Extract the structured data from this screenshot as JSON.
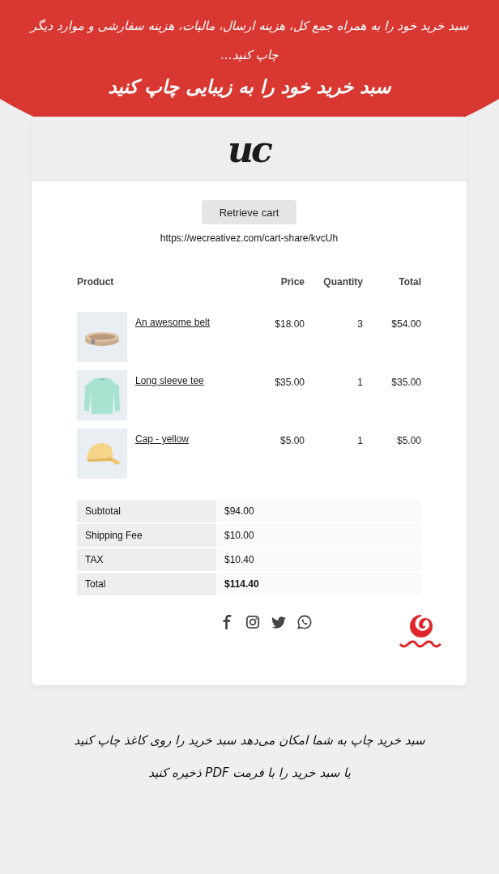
{
  "banner": {
    "subtitle": "سبد خرید خود را به همراه جمع کل، هزینه ارسال، مالیات، هزینه سفارشی و موارد دیگر چاپ کنید...",
    "title": "سبد خرید خود را به زیبایی چاپ کنید"
  },
  "card": {
    "logo": "uc",
    "retrieve_button": "Retrieve cart",
    "share_url": "https://wecreativez.com/cart-share/kvcUh",
    "table": {
      "columns": [
        "Product",
        "Price",
        "Quantity",
        "Total"
      ],
      "rows": [
        {
          "kind": "belt",
          "name": "An awesome belt",
          "price": "$18.00",
          "quantity": "3",
          "total": "$54.00"
        },
        {
          "kind": "shirt",
          "name": "Long sleeve tee",
          "price": "$35.00",
          "quantity": "1",
          "total": "$35.00"
        },
        {
          "kind": "cap",
          "name": "Cap - yellow",
          "price": "$5.00",
          "quantity": "1",
          "total": "$5.00"
        }
      ]
    },
    "totals": [
      {
        "label": "Subtotal",
        "value": "$94.00",
        "bold": false
      },
      {
        "label": "Shipping Fee",
        "value": "$10.00",
        "bold": false
      },
      {
        "label": "TAX",
        "value": "$10.40",
        "bold": false
      },
      {
        "label": "Total",
        "value": "$114.40",
        "bold": true
      }
    ],
    "social": [
      {
        "kind": "facebook"
      },
      {
        "kind": "instagram"
      },
      {
        "kind": "twitter"
      },
      {
        "kind": "whatsapp"
      }
    ]
  },
  "footer": {
    "lines": [
      "سبد خرید چاپ به شما امکان می‌دهد سبد خرید را روی کاغذ چاپ کنید",
      "یا سبد خرید را با فرمت PDF ذخیره کنید"
    ]
  }
}
